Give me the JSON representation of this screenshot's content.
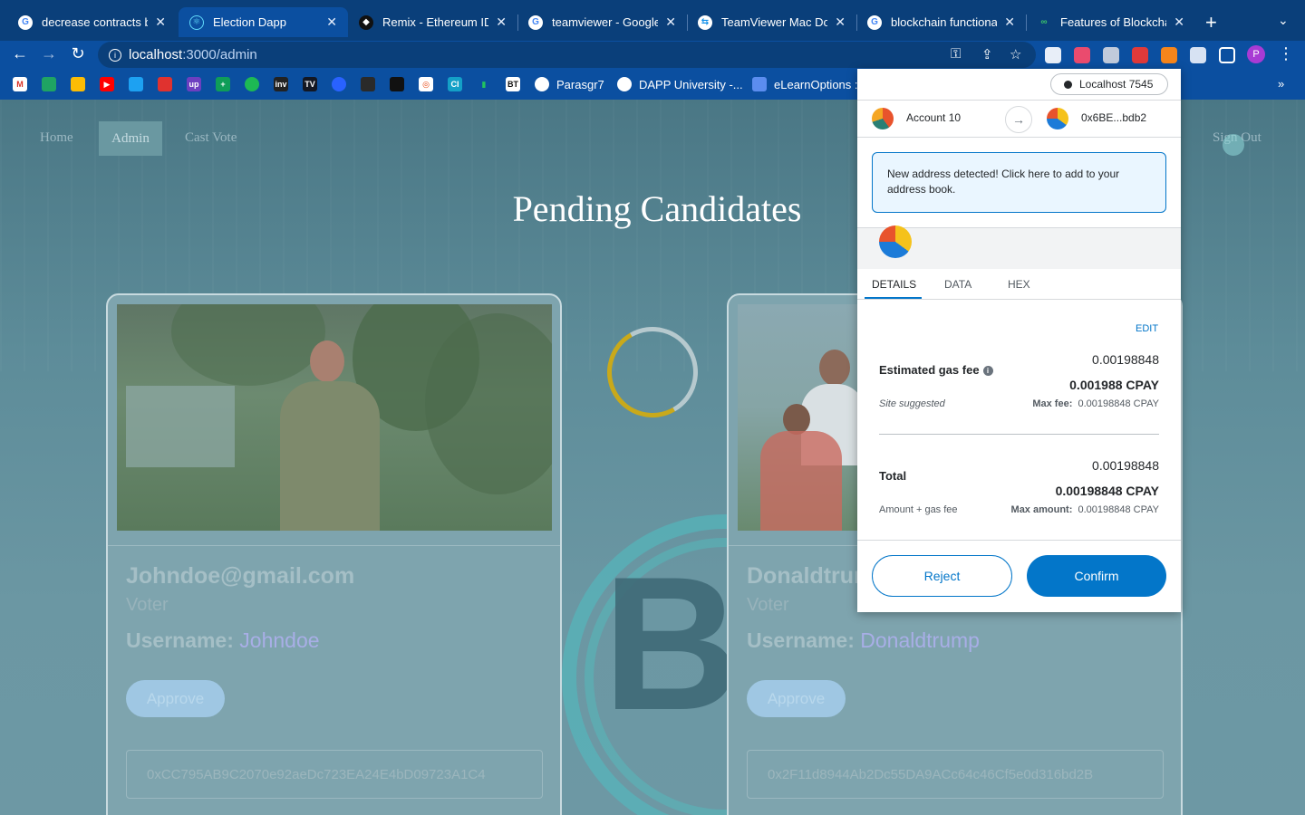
{
  "browser": {
    "tabs": [
      {
        "title": "decrease contracts b",
        "favicon": "google-icon",
        "active": false
      },
      {
        "title": "Election Dapp",
        "favicon": "react-icon",
        "active": true
      },
      {
        "title": "Remix - Ethereum IDE",
        "favicon": "remix-icon",
        "active": false
      },
      {
        "title": "teamviewer - Google",
        "favicon": "google-icon",
        "active": false
      },
      {
        "title": "TeamViewer Mac Dow",
        "favicon": "teamviewer-icon",
        "active": false
      },
      {
        "title": "blockchain functional",
        "favicon": "google-icon",
        "active": false
      },
      {
        "title": "Features of Blockchai",
        "favicon": "site-icon",
        "active": false
      }
    ],
    "url_host": "localhost",
    "url_path": ":3000/admin",
    "bookmarks": [
      "Parasgr7",
      "DAPP University -...",
      "eLearnOptions :"
    ],
    "profile_initial": "P",
    "extension_badge": "1"
  },
  "site": {
    "nav": {
      "home": "Home",
      "admin": "Admin",
      "cast_vote": "Cast Vote",
      "sign_out": "Sign Out"
    },
    "title": "Pending Candidates",
    "candidates": [
      {
        "email": "Johndoe@gmail.com",
        "role": "Voter",
        "username_label": "Username:",
        "username": "Johndoe",
        "approve": "Approve",
        "address": "0xCC795AB9C2070e92aeDc723EA24E4bD09723A1C4"
      },
      {
        "email": "Donaldtrump@gmail.com",
        "role": "Voter",
        "username_label": "Username:",
        "username": "Donaldtrump",
        "approve": "Approve",
        "address": "0x2F11d8944Ab2Dc55DA9ACc64c46Cf5e0d316bd2B"
      }
    ]
  },
  "metamask": {
    "network": "Localhost 7545",
    "from_account": "Account 10",
    "to_address": "0x6BE...bdb2",
    "notice": "New address detected! Click here to add to your address book.",
    "tabs": [
      "DETAILS",
      "DATA",
      "HEX"
    ],
    "edit": "EDIT",
    "gas_label": "Estimated gas fee",
    "gas_value": "0.00198848",
    "gas_value_bold": "0.001988 CPAY",
    "site_suggested": "Site suggested",
    "max_fee_label": "Max fee:",
    "max_fee_value": "0.00198848 CPAY",
    "total_label": "Total",
    "total_value": "0.00198848",
    "total_value_bold": "0.00198848 CPAY",
    "amount_gas_label": "Amount + gas fee",
    "max_amount_label": "Max amount:",
    "max_amount_value": "0.00198848 CPAY",
    "reject": "Reject",
    "confirm": "Confirm"
  },
  "colors": {
    "metamask_blue": "#0376c9",
    "chrome_blue": "#0b4fa0",
    "page_teal": "#5d8c99"
  }
}
